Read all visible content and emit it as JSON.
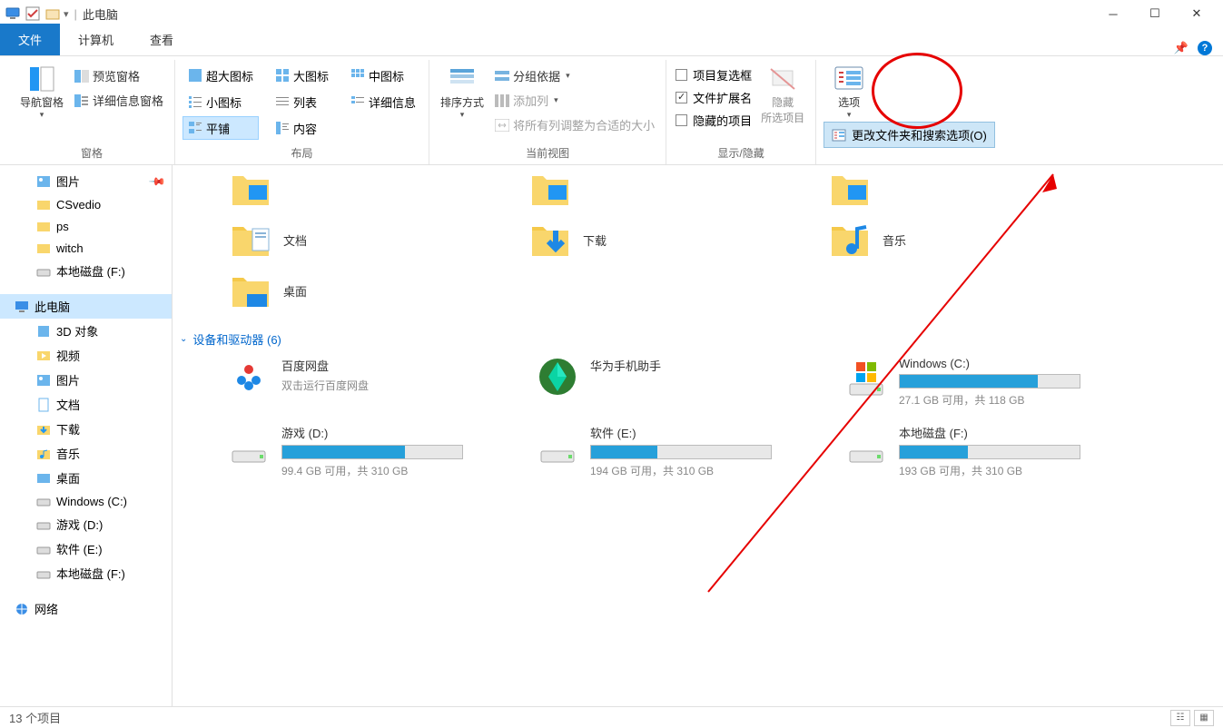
{
  "window": {
    "title": "此电脑"
  },
  "tabs": {
    "file": "文件",
    "computer": "计算机",
    "view": "查看"
  },
  "ribbon": {
    "pane": {
      "nav": "导航窗格",
      "preview": "预览窗格",
      "detail": "详细信息窗格",
      "label": "窗格"
    },
    "layout": {
      "opts": [
        "超大图标",
        "大图标",
        "中图标",
        "小图标",
        "列表",
        "详细信息",
        "平铺",
        "内容"
      ],
      "label": "布局"
    },
    "view": {
      "sort": "排序方式",
      "group": "分组依据",
      "addcol": "添加列",
      "autosize": "将所有列调整为合适的大小",
      "label": "当前视图"
    },
    "showhide": {
      "chk1": "项目复选框",
      "chk2": "文件扩展名",
      "chk3": "隐藏的项目",
      "hidesel": "隐藏\n所选项目",
      "label": "显示/隐藏"
    },
    "options": {
      "btn": "选项",
      "dd": "更改文件夹和搜索选项(O)"
    }
  },
  "nav": {
    "items": [
      {
        "label": "图片",
        "icon": "img",
        "pin": true,
        "L": 1
      },
      {
        "label": "CSvedio",
        "icon": "fld",
        "L": 1
      },
      {
        "label": "ps",
        "icon": "fld",
        "L": 1
      },
      {
        "label": "witch",
        "icon": "fld",
        "L": 1
      },
      {
        "label": "本地磁盘 (F:)",
        "icon": "dsk",
        "L": 1
      },
      {
        "label": "此电脑",
        "icon": "pc",
        "sel": true,
        "L": 0
      },
      {
        "label": "3D 对象",
        "icon": "3d",
        "L": 1
      },
      {
        "label": "视频",
        "icon": "vid",
        "L": 1
      },
      {
        "label": "图片",
        "icon": "img",
        "L": 1
      },
      {
        "label": "文档",
        "icon": "doc",
        "L": 1
      },
      {
        "label": "下载",
        "icon": "dl",
        "L": 1
      },
      {
        "label": "音乐",
        "icon": "mus",
        "L": 1
      },
      {
        "label": "桌面",
        "icon": "desk",
        "L": 1
      },
      {
        "label": "Windows (C:)",
        "icon": "dsk",
        "L": 1
      },
      {
        "label": "游戏 (D:)",
        "icon": "dsk",
        "L": 1
      },
      {
        "label": "软件 (E:)",
        "icon": "dsk",
        "L": 1
      },
      {
        "label": "本地磁盘 (F:)",
        "icon": "dsk",
        "L": 1
      },
      {
        "label": "网络",
        "icon": "net",
        "L": 0
      }
    ]
  },
  "content": {
    "folders_row1": [
      {
        "label": ""
      },
      {
        "label": ""
      },
      {
        "label": ""
      }
    ],
    "folders_row2": [
      {
        "label": "文档"
      },
      {
        "label": "下载"
      },
      {
        "label": "音乐"
      }
    ],
    "folders_row3": [
      {
        "label": "桌面"
      }
    ],
    "group_hdr": "设备和驱动器 (6)",
    "drv_row1": [
      {
        "name": "百度网盘",
        "sub": "双击运行百度网盘",
        "app": "bdp"
      },
      {
        "name": "华为手机助手",
        "app": "hw"
      },
      {
        "name": "Windows (C:)",
        "sub": "27.1 GB 可用，共 118 GB",
        "fill": 77,
        "win": true
      }
    ],
    "drv_row2": [
      {
        "name": "游戏 (D:)",
        "sub": "99.4 GB 可用，共 310 GB",
        "fill": 68
      },
      {
        "name": "软件 (E:)",
        "sub": "194 GB 可用，共 310 GB",
        "fill": 37
      },
      {
        "name": "本地磁盘 (F:)",
        "sub": "193 GB 可用，共 310 GB",
        "fill": 38
      }
    ]
  },
  "status": {
    "count": "13 个项目"
  }
}
